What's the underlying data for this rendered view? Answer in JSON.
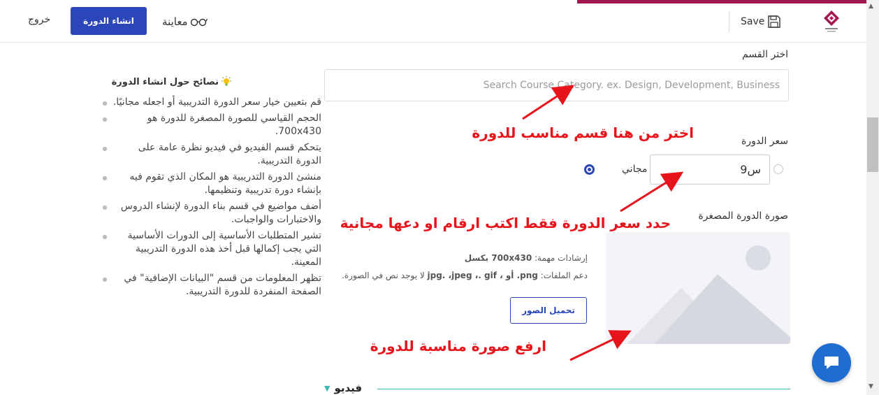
{
  "header": {
    "save_label": "Save",
    "preview_label": "معاينة",
    "create_course_label": "انشاء الدورة",
    "exit_label": "خروج"
  },
  "form": {
    "category_label": "اختر القسم",
    "category_placeholder": "Search Course Category. ex. Design, Development, Business",
    "price_label": "سعر الدورة",
    "price_value": "9س",
    "free_label": "مجاني",
    "thumbnail_label": "صورة الدورة المصغرة",
    "upload_guideline_prefix": "إرشادات مهمة: ",
    "upload_guideline_size": "700x430 بكسل",
    "upload_formats_prefix": "دعم الملفات: ",
    "upload_formats_list": "png. أو ، jpg. ،jpeg ،. gif",
    "upload_formats_suffix": " لا يوجد نص في الصورة.",
    "upload_button_label": "تحميل الصور",
    "video_heading": "فيديو"
  },
  "tips": {
    "title": "نصائح حول انشاء الدورة",
    "items": [
      "قم بتعيين خيار سعر الدورة التدريبية أو اجعله مجانيًا.",
      "الحجم القياسي للصورة المصغرة للدورة هو 700x430.",
      "يتحكم قسم الفيديو في فيديو نظرة عامة على الدورة التدريبية.",
      "منشئ الدورة التدريبية هو المكان الذي تقوم فيه بإنشاء دورة تدريبية وتنظيمها.",
      "أضف مواضيع في قسم بناء الدورة لإنشاء الدروس والاختبارات والواجبات.",
      "تشير المتطلبات الأساسية إلى الدورات الأساسية التي يجب إكمالها قبل أخذ هذه الدورة التدريبية المعينة.",
      "تظهر المعلومات من قسم \"البيانات الإضافية\" في الصفحة المنفردة للدورة التدريبية."
    ]
  },
  "annotations": {
    "category": "اختر من هنا قسم مناسب للدورة",
    "price": "حدد سعر الدورة فقط اكتب ارقام او دعها مجانية",
    "image": "ارفع صورة مناسبة للدورة"
  },
  "colors": {
    "accent": "#a3174f",
    "primary": "#2b46b8",
    "annotation": "#e8141b",
    "chat": "#1f6dd1",
    "video_line": "#3bb7b0"
  },
  "icons": {
    "save": "floppy-disk-icon",
    "preview": "glasses-icon",
    "tips": "lightbulb-icon",
    "chat": "chat-bubble-icon",
    "thumbnail": "image-placeholder-icon"
  }
}
